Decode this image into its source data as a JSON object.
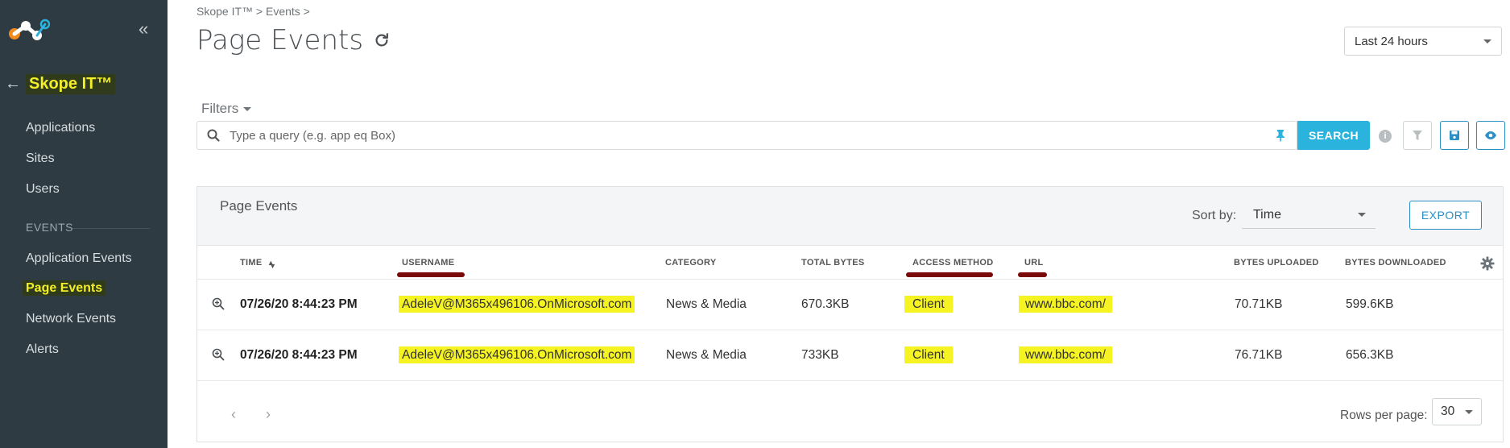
{
  "sidebar": {
    "workspace_title": "Skope IT™",
    "items": [
      {
        "label": "Applications"
      },
      {
        "label": "Sites"
      },
      {
        "label": "Users"
      }
    ],
    "section_label": "EVENTS",
    "event_items": [
      {
        "label": "Application Events"
      },
      {
        "label": "Page Events",
        "active": true
      },
      {
        "label": "Network Events"
      },
      {
        "label": "Alerts"
      }
    ]
  },
  "header": {
    "breadcrumb": "Skope IT™ > Events >",
    "title": "Page Events",
    "time_range": "Last 24 hours"
  },
  "filters": {
    "label": "Filters",
    "search_placeholder": "Type a query (e.g. app eq Box)",
    "search_button": "SEARCH"
  },
  "panel": {
    "title": "Page Events",
    "sort_label": "Sort by:",
    "sort_value": "Time",
    "export_button": "EXPORT",
    "columns": [
      "TIME",
      "USERNAME",
      "CATEGORY",
      "TOTAL BYTES",
      "ACCESS METHOD",
      "URL",
      "BYTES UPLOADED",
      "BYTES DOWNLOADED"
    ],
    "rows": [
      {
        "time": "07/26/20 8:44:23 PM",
        "username": "AdeleV@M365x496106.OnMicrosoft.com",
        "category": "News & Media",
        "total_bytes": "670.3KB",
        "access_method": "Client",
        "url": "www.bbc.com/",
        "bytes_uploaded": "70.71KB",
        "bytes_downloaded": "599.6KB"
      },
      {
        "time": "07/26/20 8:44:23 PM",
        "username": "AdeleV@M365x496106.OnMicrosoft.com",
        "category": "News & Media",
        "total_bytes": "733KB",
        "access_method": "Client",
        "url": "www.bbc.com/",
        "bytes_uploaded": "76.71KB",
        "bytes_downloaded": "656.3KB"
      }
    ],
    "rows_per_page_label": "Rows per page:",
    "rows_per_page": "30"
  },
  "colors": {
    "sidebar_bg": "#2f3b42",
    "accent_blue": "#2ab3dd",
    "highlight_yellow": "#f5f322",
    "annotation_red": "#7a0a0a"
  }
}
